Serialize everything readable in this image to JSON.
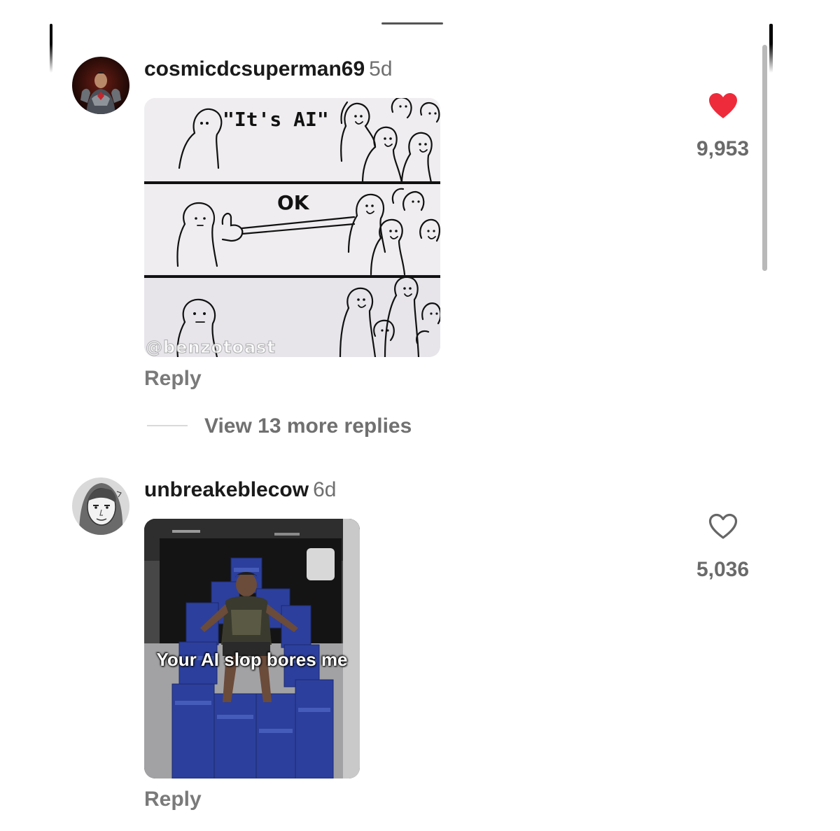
{
  "comments": [
    {
      "username": "cosmicdcsuperman69",
      "age": "5d",
      "media_caption_top": "\"It's AI\"",
      "media_caption_mid": "OK",
      "media_watermark": "@benzotoast",
      "reply_label": "Reply",
      "like_count": "9,953",
      "liked": true,
      "like_icon": "heart-filled-icon",
      "more_replies_label": "View 13 more replies"
    },
    {
      "username": "unbreakeblecow",
      "age": "6d",
      "media_caption": "Your AI slop bores me",
      "reply_label": "Reply",
      "like_count": "5,036",
      "liked": false,
      "like_icon": "heart-outline-icon"
    }
  ],
  "colors": {
    "like_red": "#ee2b3b",
    "muted_text": "#707070"
  }
}
